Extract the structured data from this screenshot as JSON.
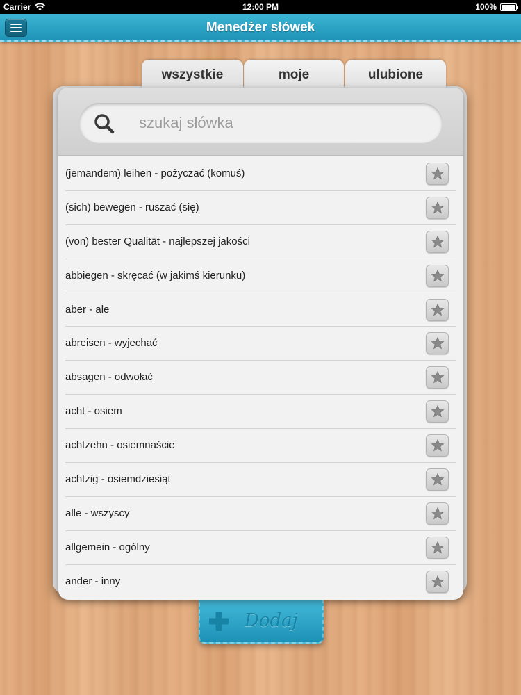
{
  "status_bar": {
    "carrier": "Carrier",
    "time": "12:00 PM",
    "battery": "100%",
    "battery_level": 1.0
  },
  "nav": {
    "title": "Menedżer słówek",
    "menu_icon": "hamburger-menu-icon"
  },
  "tabs": [
    {
      "label": "wszystkie",
      "active": true
    },
    {
      "label": "moje",
      "active": false
    },
    {
      "label": "ulubione",
      "active": false
    }
  ],
  "search": {
    "placeholder": "szukaj słówka",
    "value": "",
    "icon": "search-icon"
  },
  "words": [
    {
      "text": "(jemandem) leihen - pożyczać (komuś)"
    },
    {
      "text": "(sich) bewegen - ruszać (się)"
    },
    {
      "text": "(von) bester Qualität - najlepszej jakości"
    },
    {
      "text": "abbiegen - skręcać (w jakimś kierunku)"
    },
    {
      "text": "aber - ale"
    },
    {
      "text": "abreisen - wyjechać"
    },
    {
      "text": "absagen - odwołać"
    },
    {
      "text": "acht - osiem"
    },
    {
      "text": "achtzehn - osiemnaście"
    },
    {
      "text": "achtzig - osiemdziesiąt"
    },
    {
      "text": "alle - wszyscy"
    },
    {
      "text": "allgemein - ogólny"
    },
    {
      "text": "ander - inny"
    }
  ],
  "add_button": {
    "label": "Dodaj",
    "icon": "plus-icon"
  },
  "colors": {
    "nav_blue": "#2aa5c8",
    "add_blue": "#2aa5c8",
    "panel": "#f2f2f2"
  }
}
